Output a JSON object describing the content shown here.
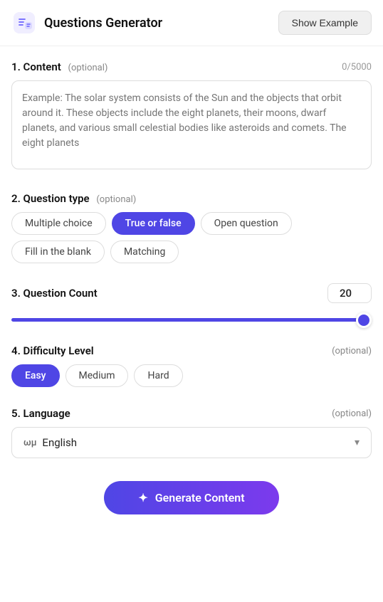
{
  "header": {
    "title": "Questions Generator",
    "show_example_label": "Show Example",
    "icon": "🧩"
  },
  "sections": {
    "content": {
      "label": "1. Content",
      "optional": "(optional)",
      "char_count": "0/5000",
      "placeholder": "Example: The solar system consists of the Sun and the objects that orbit around it. These objects include the eight planets, their moons, dwarf planets, and various small celestial bodies like asteroids and comets. The eight planets"
    },
    "question_type": {
      "label": "2. Question type",
      "optional": "(optional)",
      "options": [
        {
          "id": "multiple-choice",
          "label": "Multiple choice",
          "active": false
        },
        {
          "id": "true-or-false",
          "label": "True or false",
          "active": true
        },
        {
          "id": "open-question",
          "label": "Open question",
          "active": false
        },
        {
          "id": "fill-in-the-blank",
          "label": "Fill in the blank",
          "active": false
        },
        {
          "id": "matching",
          "label": "Matching",
          "active": false
        }
      ]
    },
    "question_count": {
      "label": "3. Question Count",
      "value": 20,
      "min": 1,
      "max": 20,
      "slider_percent": 96
    },
    "difficulty_level": {
      "label": "4. Difficulty Level",
      "optional": "(optional)",
      "options": [
        {
          "id": "easy",
          "label": "Easy",
          "active": true
        },
        {
          "id": "medium",
          "label": "Medium",
          "active": false
        },
        {
          "id": "hard",
          "label": "Hard",
          "active": false
        }
      ]
    },
    "language": {
      "label": "5. Language",
      "optional": "(optional)",
      "flag": "ωμ",
      "value": "English"
    }
  },
  "generate_button": {
    "label": "Generate Content",
    "sparkle": "✦"
  }
}
